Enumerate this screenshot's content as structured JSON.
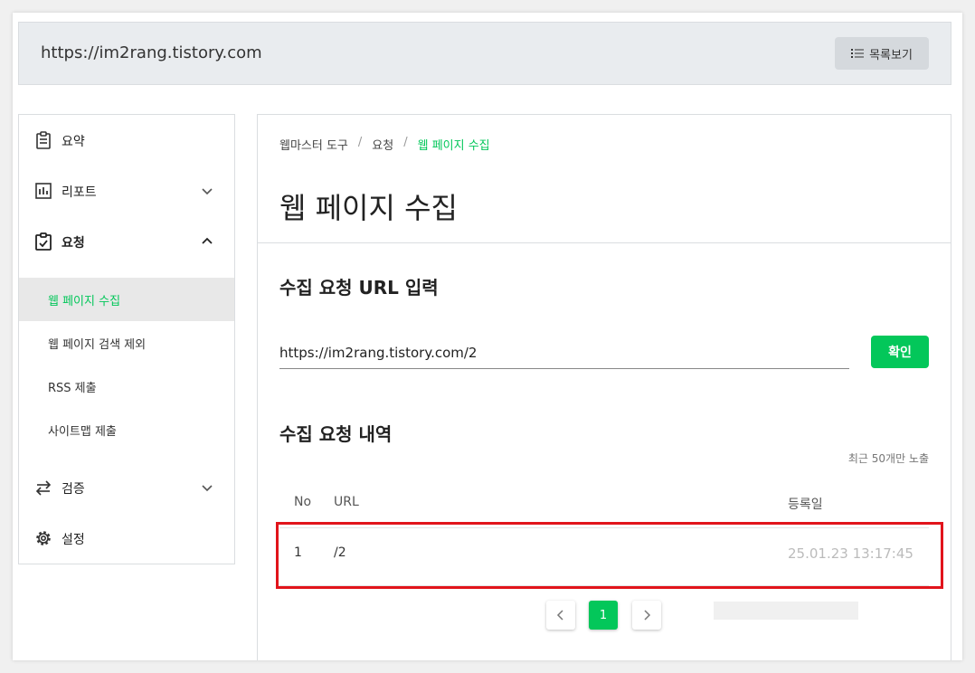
{
  "header": {
    "site_url": "https://im2rang.tistory.com",
    "list_button_label": "목록보기"
  },
  "sidebar": {
    "items": [
      {
        "label": "요약",
        "icon": "clipboard-icon"
      },
      {
        "label": "리포트",
        "icon": "report-chart-icon"
      },
      {
        "label": "요청",
        "icon": "clipboard-check-icon"
      },
      {
        "label": "검증",
        "icon": "swap-arrows-icon"
      },
      {
        "label": "설정",
        "icon": "gear-icon"
      }
    ],
    "sub_items": [
      {
        "label": "웹 페이지 수집",
        "active": true
      },
      {
        "label": "웹 페이지 검색 제외",
        "active": false
      },
      {
        "label": "RSS 제출",
        "active": false
      },
      {
        "label": "사이트맵 제출",
        "active": false
      }
    ]
  },
  "main": {
    "breadcrumb": [
      "웹마스터 도구",
      "요청",
      "웹 페이지 수집"
    ],
    "breadcrumb_sep": "/",
    "page_title": "웹 페이지 수집",
    "input_section_title": "수집 요청 URL 입력",
    "url_input_value": "https://im2rang.tistory.com/2",
    "confirm_label": "확인",
    "history_title": "수집 요청 내역",
    "recent_note": "최근 50개만 노출",
    "table": {
      "headers": [
        "No",
        "URL",
        "등록일"
      ],
      "rows": [
        {
          "no": "1",
          "url": "/2",
          "date": "25.01.23 13:17:45"
        }
      ]
    },
    "pagination": {
      "current_page": "1"
    }
  },
  "colors": {
    "accent": "#03c75a",
    "highlight": "#e1141b"
  }
}
